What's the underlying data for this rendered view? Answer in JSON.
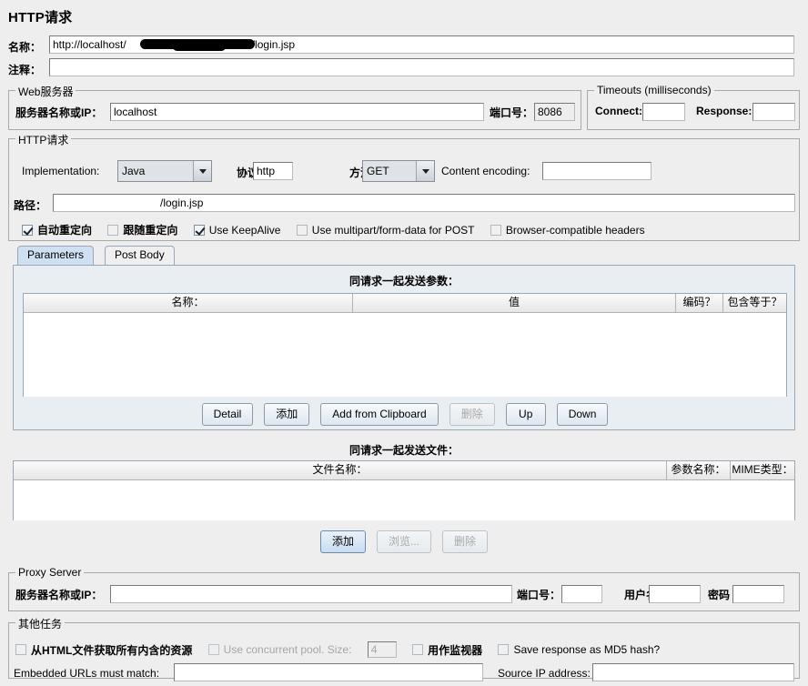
{
  "page_title": "HTTP请求",
  "colors": {
    "background": "#eeeeee",
    "field_bg": "#ffffff",
    "border": "#a9a9a9",
    "tab_active_bg": "#cfe0f2",
    "combo_bg": "#dfe3e8",
    "disabled_text": "#a6a6a6",
    "redaction": "#000000"
  },
  "name_row": {
    "label": "名称：",
    "value": "http://localhost/                              /login.jsp",
    "value_prefix": "http://localhost/",
    "value_suffix": "/login.jsp",
    "redacted": true
  },
  "comment_row": {
    "label": "注释：",
    "value": ""
  },
  "web_server": {
    "group_label": "Web服务器",
    "server_label": "服务器名称或IP：",
    "server_value": "localhost",
    "port_label": "端口号：",
    "port_value": "8086"
  },
  "timeouts": {
    "group_label": "Timeouts (milliseconds)",
    "connect_label": "Connect:",
    "connect_value": "",
    "response_label": "Response:",
    "response_value": ""
  },
  "http_request": {
    "group_label": "HTTP请求",
    "implementation_label": "Implementation:",
    "implementation_value": "Java",
    "protocol_label": "协议：",
    "protocol_value": "http",
    "method_label": "方法：",
    "method_value": "GET",
    "content_encoding_label": "Content encoding:",
    "content_encoding_value": "",
    "path_label": "路径：",
    "path_value": "/login.jsp",
    "path_suffix": "/login.jsp",
    "path_redacted": true,
    "checkboxes": [
      {
        "label": "自动重定向",
        "checked": true,
        "enabled": true
      },
      {
        "label": "跟随重定向",
        "checked": false,
        "enabled": true
      },
      {
        "label": "Use KeepAlive",
        "checked": true,
        "enabled": true
      },
      {
        "label": "Use multipart/form-data for POST",
        "checked": false,
        "enabled": true
      },
      {
        "label": "Browser-compatible headers",
        "checked": false,
        "enabled": true
      }
    ]
  },
  "tabs": [
    {
      "label": "Parameters",
      "active": true
    },
    {
      "label": "Post Body",
      "active": false
    }
  ],
  "parameters_section": {
    "caption": "同请求一起发送参数：",
    "columns": [
      "名称：",
      "值",
      "编码？",
      "包含等于？"
    ],
    "rows": [],
    "buttons": [
      {
        "label": "Detail",
        "enabled": true,
        "focused": false
      },
      {
        "label": "添加",
        "enabled": true,
        "focused": false
      },
      {
        "label": "Add from Clipboard",
        "enabled": true,
        "focused": false
      },
      {
        "label": "删除",
        "enabled": false,
        "focused": false
      },
      {
        "label": "Up",
        "enabled": true,
        "focused": false
      },
      {
        "label": "Down",
        "enabled": true,
        "focused": false
      }
    ]
  },
  "files_section": {
    "caption": "同请求一起发送文件：",
    "columns": [
      "文件名称：",
      "参数名称：",
      "MIME类型："
    ],
    "rows": [],
    "buttons": [
      {
        "label": "添加",
        "enabled": true,
        "focused": true
      },
      {
        "label": "浏览...",
        "enabled": false,
        "focused": false
      },
      {
        "label": "删除",
        "enabled": false,
        "focused": false
      }
    ]
  },
  "proxy_server": {
    "group_label": "Proxy Server",
    "server_label": "服务器名称或IP：",
    "server_value": "",
    "port_label": "端口号：",
    "port_value": "",
    "username_label": "用户名",
    "username_value": "",
    "password_label": "密码",
    "password_value": ""
  },
  "other_tasks": {
    "group_label": "其他任务",
    "checkboxes": [
      {
        "label": "从HTML文件获取所有内含的资源",
        "checked": false,
        "enabled": true
      },
      {
        "label": "Use concurrent pool. Size:",
        "checked": false,
        "enabled": false
      },
      {
        "label": "用作监视器",
        "checked": false,
        "enabled": true
      },
      {
        "label": "Save response as MD5 hash?",
        "checked": false,
        "enabled": true
      }
    ],
    "pool_size_value": "4",
    "pool_size_enabled": false,
    "embedded_urls_label": "Embedded URLs must match:",
    "embedded_urls_value": "",
    "source_ip_label": "Source IP address:",
    "source_ip_value": ""
  }
}
